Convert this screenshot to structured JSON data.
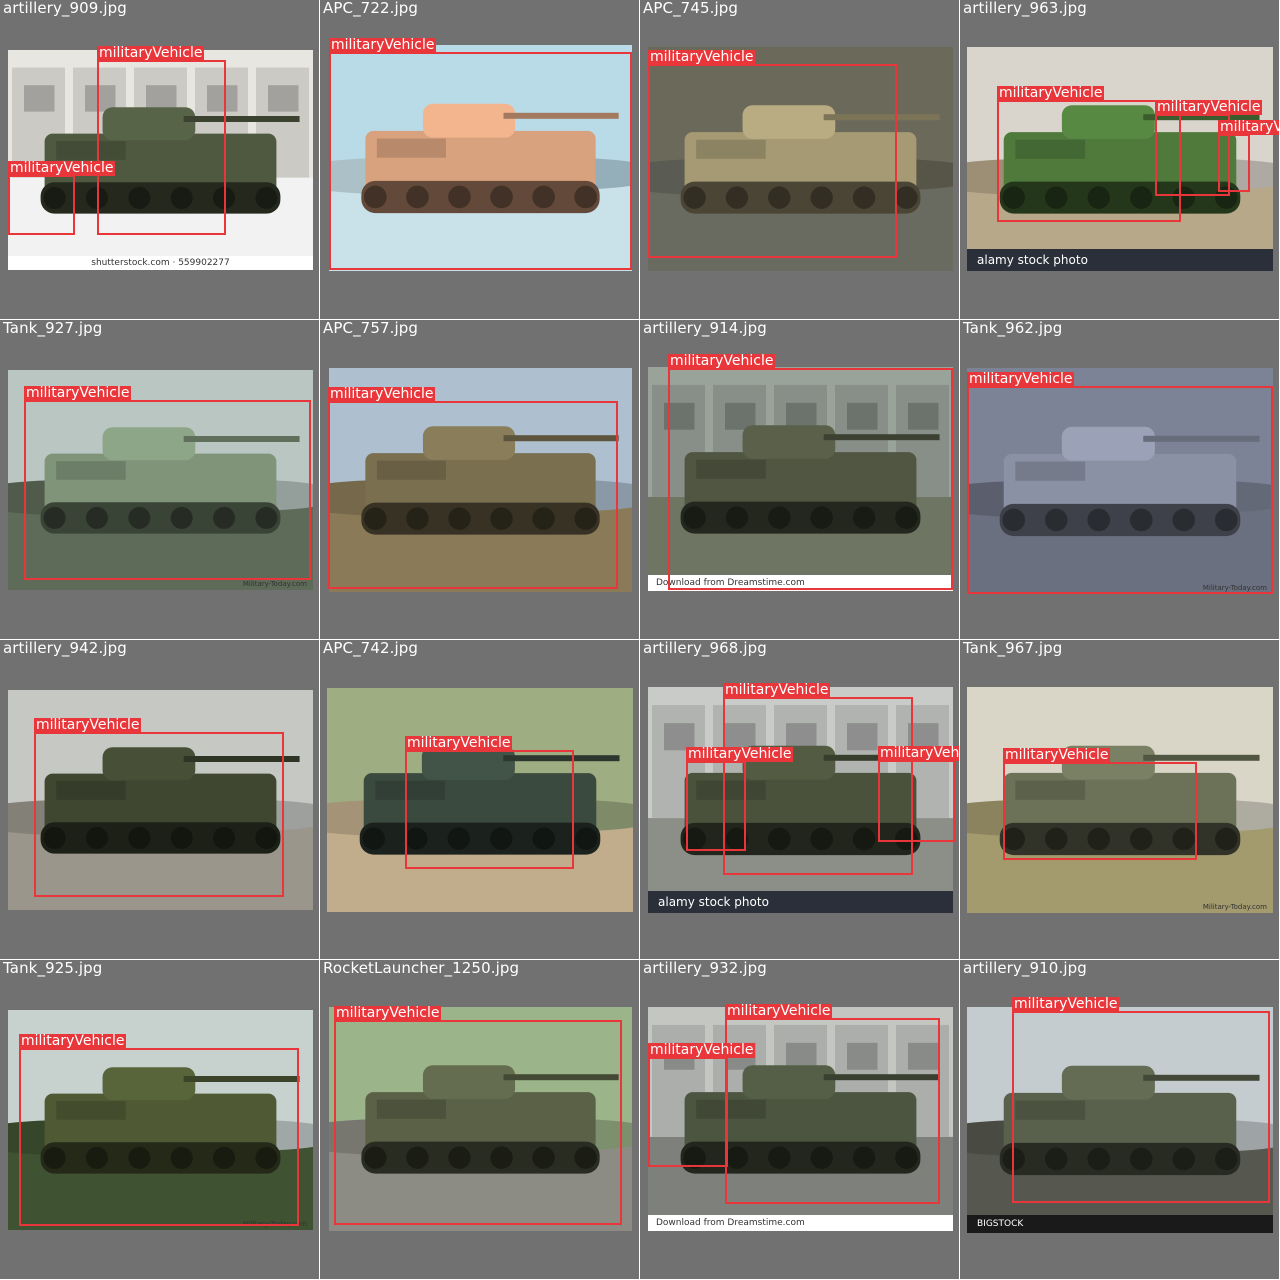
{
  "colors": {
    "tile_bg": "#717171",
    "box": "#e8363a",
    "label_text": "#ffffff"
  },
  "tiles": [
    {
      "file": "artillery_909.jpg",
      "watermark": "shutterstock.com · 559902277",
      "boxes": [
        {
          "label": "militaryVehicle"
        },
        {
          "label": "militaryVehicle"
        }
      ]
    },
    {
      "file": "APC_722.jpg",
      "watermark": "",
      "boxes": [
        {
          "label": "militaryVehicle"
        }
      ]
    },
    {
      "file": "APC_745.jpg",
      "watermark": "",
      "boxes": [
        {
          "label": "militaryVehicle"
        }
      ]
    },
    {
      "file": "artillery_963.jpg",
      "watermark": "alamy stock photo",
      "boxes": [
        {
          "label": "militaryVehicle"
        },
        {
          "label": "militaryVehicle"
        },
        {
          "label": "militaryVehicle"
        }
      ]
    },
    {
      "file": "Tank_927.jpg",
      "watermark": "Military-Today.com",
      "boxes": [
        {
          "label": "militaryVehicle"
        }
      ]
    },
    {
      "file": "APC_757.jpg",
      "watermark": "",
      "boxes": [
        {
          "label": "militaryVehicle"
        }
      ]
    },
    {
      "file": "artillery_914.jpg",
      "watermark": "Download from Dreamstime.com",
      "boxes": [
        {
          "label": "militaryVehicle"
        }
      ]
    },
    {
      "file": "Tank_962.jpg",
      "watermark": "Military-Today.com",
      "boxes": [
        {
          "label": "militaryVehicle"
        }
      ]
    },
    {
      "file": "artillery_942.jpg",
      "watermark": "",
      "boxes": [
        {
          "label": "militaryVehicle"
        }
      ]
    },
    {
      "file": "APC_742.jpg",
      "watermark": "",
      "boxes": [
        {
          "label": "militaryVehicle"
        }
      ]
    },
    {
      "file": "artillery_968.jpg",
      "watermark": "alamy stock photo",
      "boxes": [
        {
          "label": "militaryVehicle"
        },
        {
          "label": "militaryVehicle"
        },
        {
          "label": "militaryVehicle"
        }
      ]
    },
    {
      "file": "Tank_967.jpg",
      "watermark": "Military-Today.com",
      "boxes": [
        {
          "label": "militaryVehicle"
        }
      ]
    },
    {
      "file": "Tank_925.jpg",
      "watermark": "Military-Today.com",
      "boxes": [
        {
          "label": "militaryVehicle"
        }
      ]
    },
    {
      "file": "RocketLauncher_1250.jpg",
      "watermark": "",
      "boxes": [
        {
          "label": "militaryVehicle"
        }
      ]
    },
    {
      "file": "artillery_932.jpg",
      "watermark": "Download from Dreamstime.com",
      "boxes": [
        {
          "label": "militaryVehicle"
        },
        {
          "label": "militaryVehicle"
        }
      ]
    },
    {
      "file": "artillery_910.jpg",
      "watermark": "BIGSTOCK",
      "boxes": [
        {
          "label": "militaryVehicle"
        }
      ]
    }
  ]
}
